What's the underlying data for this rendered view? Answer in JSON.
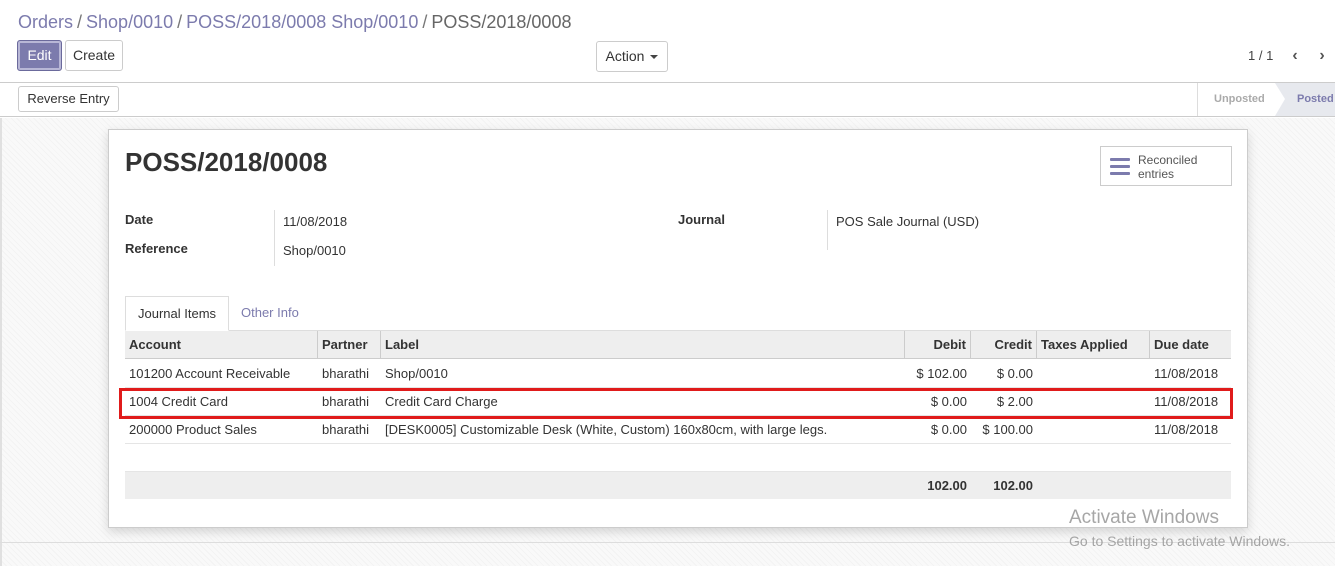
{
  "breadcrumb": {
    "items": [
      "Orders",
      "Shop/0010",
      "POSS/2018/0008 Shop/0010"
    ],
    "active": "POSS/2018/0008",
    "separator": "/"
  },
  "toolbar": {
    "edit_label": "Edit",
    "create_label": "Create",
    "action_label": "Action"
  },
  "pager": {
    "value": "1 / 1"
  },
  "statusbar": {
    "reverse_label": "Reverse Entry",
    "stages": [
      "Unposted",
      "Posted"
    ],
    "current_stage": "Posted"
  },
  "record": {
    "title": "POSS/2018/0008",
    "smart_button": {
      "line1": "Reconciled",
      "line2": "entries",
      "icon": "list-icon"
    },
    "fields": {
      "date_label": "Date",
      "date_value": "11/08/2018",
      "reference_label": "Reference",
      "reference_value": "Shop/0010",
      "journal_label": "Journal",
      "journal_value": "POS Sale Journal (USD)"
    }
  },
  "tabs": [
    "Journal Items",
    "Other Info"
  ],
  "table": {
    "headers": [
      "Account",
      "Partner",
      "Label",
      "Debit",
      "Credit",
      "Taxes Applied",
      "Due date"
    ],
    "rows": [
      [
        "101200 Account Receivable",
        "bharathi",
        "Shop/0010",
        "$ 102.00",
        "$ 0.00",
        "",
        "11/08/2018"
      ],
      [
        "1004 Credit Card",
        "bharathi",
        "Credit Card Charge",
        "$ 0.00",
        "$ 2.00",
        "",
        "11/08/2018"
      ],
      [
        "200000 Product Sales",
        "bharathi",
        "[DESK0005] Customizable Desk (White, Custom) 160x80cm, with large legs.",
        "$ 0.00",
        "$ 100.00",
        "",
        "11/08/2018"
      ]
    ],
    "totals": {
      "debit": "102.00",
      "credit": "102.00"
    }
  },
  "watermark": {
    "line1": "Activate Windows",
    "line2": "Go to Settings to activate Windows."
  },
  "colors": {
    "primary": "#7c7bad",
    "highlight": "#e01b1b"
  }
}
